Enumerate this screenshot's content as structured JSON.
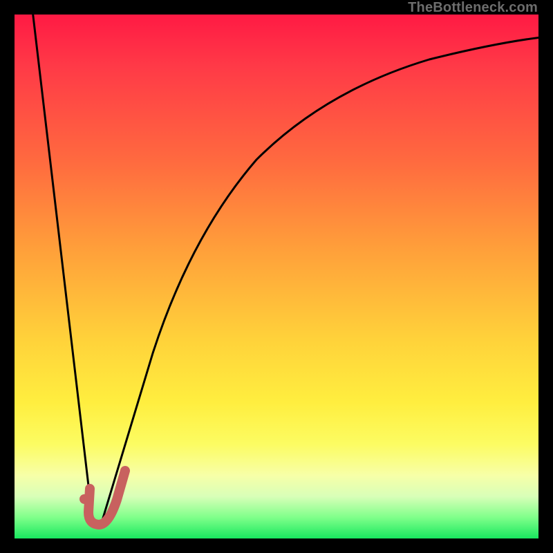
{
  "watermark": "TheBottleneck.com",
  "colors": {
    "background": "#000000",
    "gradient_top": "#ff1a44",
    "gradient_mid1": "#ff6a3f",
    "gradient_mid2": "#ffee3f",
    "gradient_bottom": "#18e85f",
    "curve_stroke": "#000000",
    "marker_stroke": "#c8615f",
    "marker_fill": "#c8615f"
  },
  "chart_data": {
    "type": "line",
    "title": "",
    "xlabel": "",
    "ylabel": "",
    "xlim": [
      0,
      100
    ],
    "ylim": [
      0,
      100
    ],
    "series": [
      {
        "name": "left-branch",
        "x": [
          3.4,
          14.8
        ],
        "y": [
          100,
          4.5
        ]
      },
      {
        "name": "right-branch",
        "x": [
          16.6,
          18,
          20,
          23,
          26,
          30,
          35,
          40,
          46,
          52,
          60,
          70,
          82,
          92,
          100
        ],
        "y": [
          3.0,
          8,
          15,
          26,
          36,
          46,
          56,
          63,
          70,
          75,
          80,
          84.5,
          88,
          90,
          91.5
        ]
      }
    ],
    "marker": {
      "name": "J-marker",
      "dot": {
        "x": 13.3,
        "y": 7.5
      },
      "hook": [
        {
          "x": 14.4,
          "y": 9.5
        },
        {
          "x": 14.1,
          "y": 5.0
        },
        {
          "x": 14.6,
          "y": 3.4
        },
        {
          "x": 16.1,
          "y": 2.8
        },
        {
          "x": 17.8,
          "y": 3.4
        },
        {
          "x": 19.5,
          "y": 7.5
        },
        {
          "x": 21.0,
          "y": 13.0
        }
      ]
    }
  }
}
